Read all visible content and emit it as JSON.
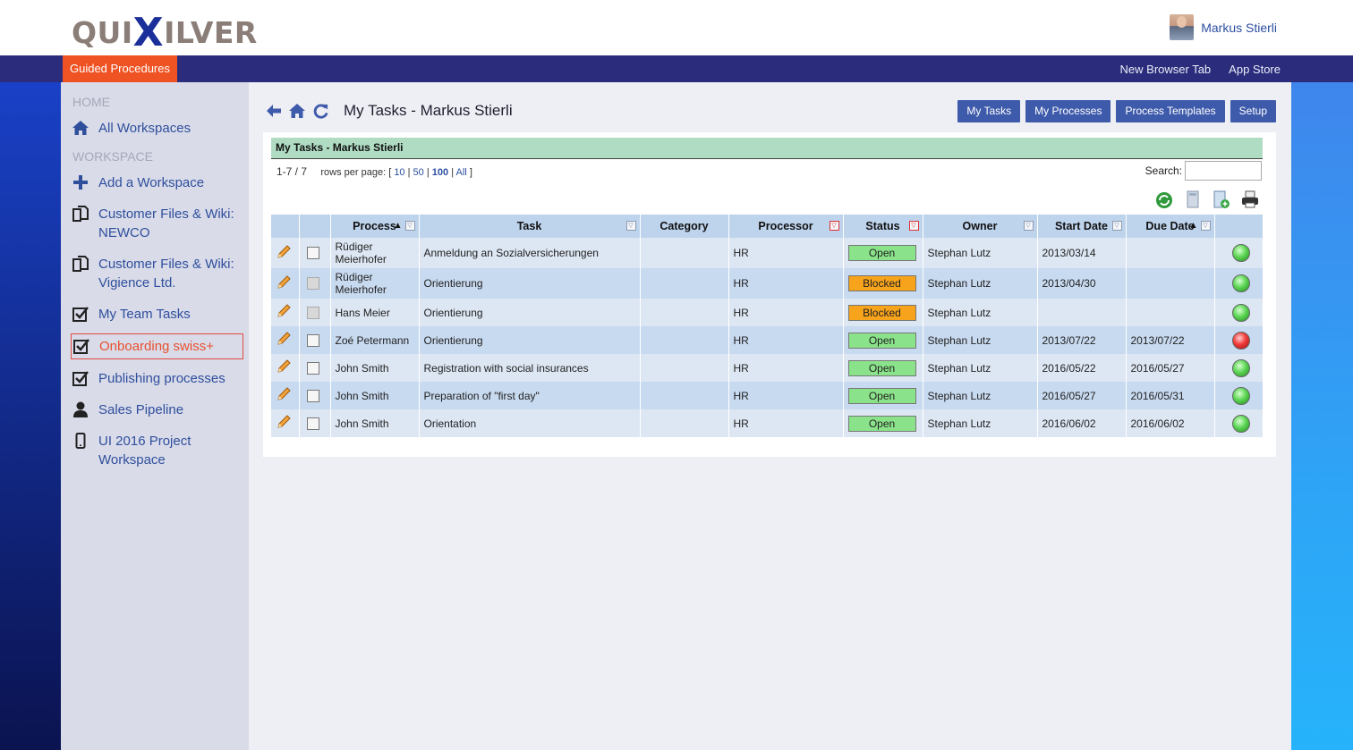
{
  "header": {
    "logo_left": "QUI",
    "logo_x": "X",
    "logo_right": "ILVER",
    "user_name": "Markus Stierli"
  },
  "navbar": {
    "guided": "Guided Procedures",
    "links": [
      "New Browser Tab",
      "App Store"
    ]
  },
  "sidebar": {
    "home_label": "HOME",
    "workspace_label": "WORKSPACE",
    "items": [
      {
        "label": "All Workspaces",
        "icon": "home-icon"
      },
      {
        "label": "Add a Workspace",
        "icon": "plus-icon"
      },
      {
        "label": "Customer Files & Wiki: NEWCO",
        "icon": "copy-icon"
      },
      {
        "label": "Customer Files & Wiki: Vigience Ltd.",
        "icon": "copy-icon"
      },
      {
        "label": "My Team Tasks",
        "icon": "checkbox-icon"
      },
      {
        "label": "Onboarding swiss+",
        "icon": "checkbox-icon",
        "active": true
      },
      {
        "label": "Publishing processes",
        "icon": "checkbox-icon"
      },
      {
        "label": "Sales Pipeline",
        "icon": "user-icon"
      },
      {
        "label": "UI 2016 Project Workspace",
        "icon": "mobile-icon"
      }
    ]
  },
  "main": {
    "title": "My Tasks - Markus Stierli",
    "buttons": [
      "My Tasks",
      "My Processes",
      "Process Templates",
      "Setup"
    ],
    "grid_title": "My Tasks - Markus Stierli",
    "pager": {
      "range": "1-7 / 7",
      "rpp_label": "rows per page: [",
      "options": [
        "10",
        "50",
        "100",
        "All"
      ],
      "close": "]"
    },
    "search_label": "Search:",
    "columns": [
      "Process",
      "Task",
      "Category",
      "Processor",
      "Status",
      "Owner",
      "Start Date",
      "Due Date"
    ],
    "rows": [
      {
        "process": "Rüdiger Meierhofer",
        "task": "Anmeldung an Sozialversicherungen",
        "category": "",
        "processor": "HR",
        "status": "Open",
        "owner": "Stephan Lutz",
        "start": "2013/03/14",
        "due": "",
        "light": "green",
        "chk_disabled": false
      },
      {
        "process": "Rüdiger Meierhofer",
        "task": "Orientierung",
        "category": "",
        "processor": "HR",
        "status": "Blocked",
        "owner": "Stephan Lutz",
        "start": "2013/04/30",
        "due": "",
        "light": "green",
        "chk_disabled": true
      },
      {
        "process": "Hans Meier",
        "task": "Orientierung",
        "category": "",
        "processor": "HR",
        "status": "Blocked",
        "owner": "Stephan Lutz",
        "start": "",
        "due": "",
        "light": "green",
        "chk_disabled": true
      },
      {
        "process": "Zoé Petermann",
        "task": "Orientierung",
        "category": "",
        "processor": "HR",
        "status": "Open",
        "owner": "Stephan Lutz",
        "start": "2013/07/22",
        "due": "2013/07/22",
        "light": "red",
        "chk_disabled": false
      },
      {
        "process": "John Smith",
        "task": "Registration with social insurances",
        "category": "",
        "processor": "HR",
        "status": "Open",
        "owner": "Stephan Lutz",
        "start": "2016/05/22",
        "due": "2016/05/27",
        "light": "green",
        "chk_disabled": false
      },
      {
        "process": "John Smith",
        "task": "Preparation of \"first day\"",
        "category": "",
        "processor": "HR",
        "status": "Open",
        "owner": "Stephan Lutz",
        "start": "2016/05/27",
        "due": "2016/05/31",
        "light": "green",
        "chk_disabled": false
      },
      {
        "process": "John Smith",
        "task": "Orientation",
        "category": "",
        "processor": "HR",
        "status": "Open",
        "owner": "Stephan Lutz",
        "start": "2016/06/02",
        "due": "2016/06/02",
        "light": "green",
        "chk_disabled": false
      }
    ]
  },
  "colors": {
    "navbar": "#2b2d7c",
    "accent": "#ef5323",
    "button": "#3e5aab",
    "grid_title": "#b0dcc3",
    "status_open": "#8ae38a",
    "status_blocked": "#f7a31b"
  }
}
